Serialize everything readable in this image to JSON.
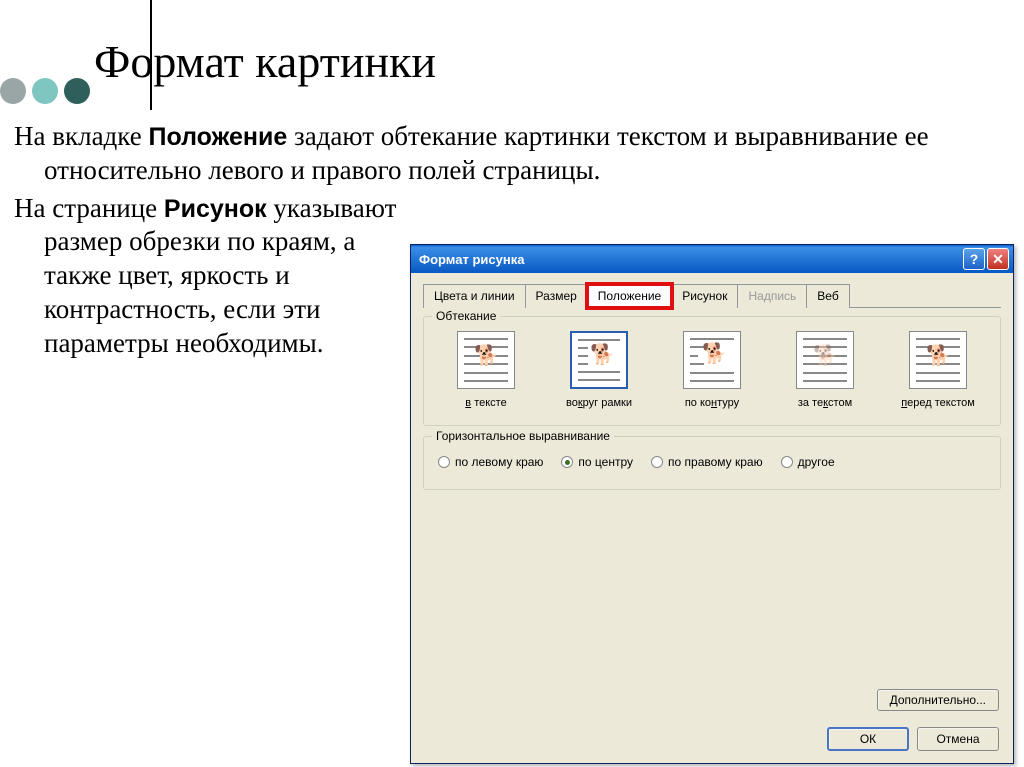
{
  "slide": {
    "title": "Формат картинки",
    "para1_a": "На вкладке ",
    "para1_bold": "Положение",
    "para1_b": " задают обтекание картинки текстом и выравнивание ее относительно левого и правого полей страницы.",
    "para2_a": "На странице ",
    "para2_bold": "Рисунок",
    "para2_b": " указывают размер обрезки по краям, а также цвет, яркость и контрастность, если эти параметры необходимы."
  },
  "dialog": {
    "title": "Формат рисунка",
    "tabs": [
      "Цвета и линии",
      "Размер",
      "Положение",
      "Рисунок",
      "Надпись",
      "Веб"
    ],
    "active_tab": 2,
    "disabled_tab": 4,
    "wrap_legend": "Обтекание",
    "wrap_options": [
      {
        "label": "в тексте"
      },
      {
        "label": "вокруг рамки"
      },
      {
        "label": "по контуру"
      },
      {
        "label": "за текстом"
      },
      {
        "label": "перед текстом"
      }
    ],
    "wrap_selected": 1,
    "align_legend": "Горизонтальное выравнивание",
    "align_options": [
      "по левому краю",
      "по центру",
      "по правому краю",
      "другое"
    ],
    "align_selected": 1,
    "btn_more": "Дополнительно...",
    "btn_ok": "ОК",
    "btn_cancel": "Отмена"
  }
}
